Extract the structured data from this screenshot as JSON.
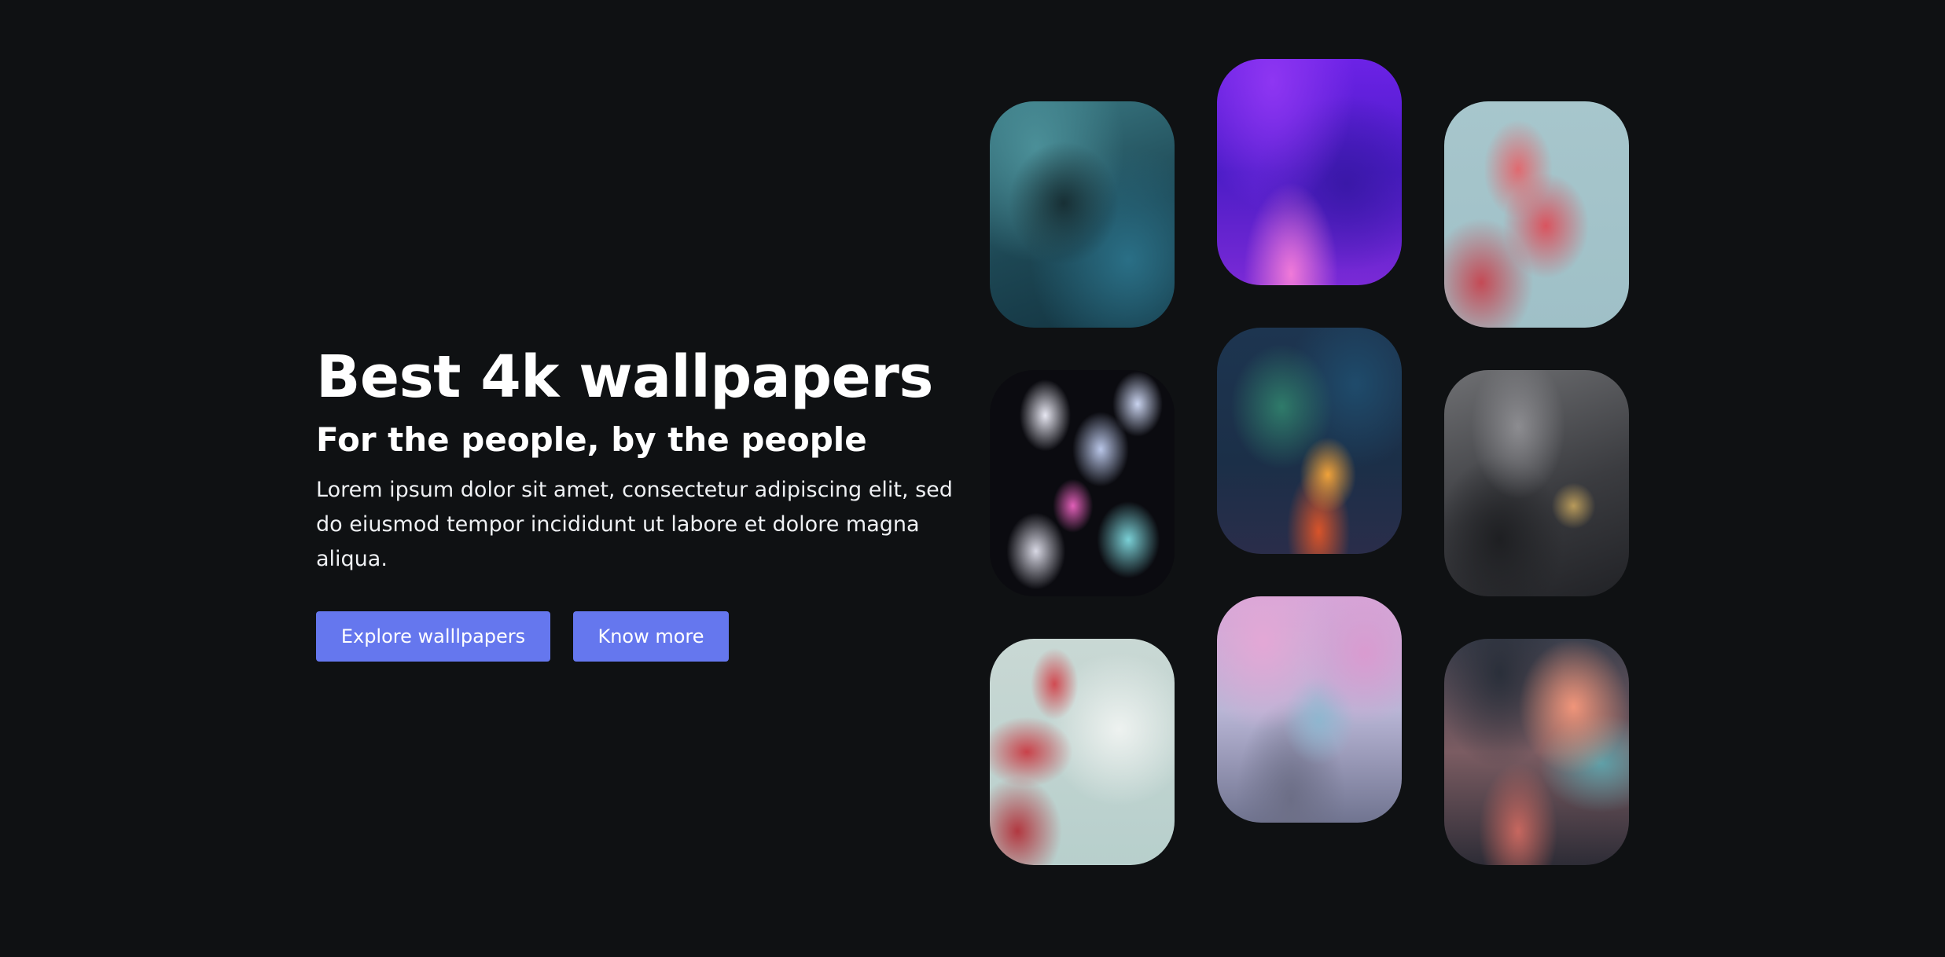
{
  "hero": {
    "title": "Best 4k wallpapers",
    "subtitle": "For the people, by the people",
    "description": "Lorem ipsum dolor sit amet, consectetur adipiscing elit, sed do eiusmod tempor incididunt ut labore et dolore magna aliqua.",
    "buttons": {
      "explore_label": "Explore walllpapers",
      "know_more_label": "Know more"
    }
  },
  "colors": {
    "background": "#0f1113",
    "accent": "#6577ee",
    "text": "#ffffff"
  },
  "wallpapers": [
    {
      "subject": "teal nebula"
    },
    {
      "subject": "purple nebula"
    },
    {
      "subject": "cherry blossom branch"
    },
    {
      "subject": "iridescent abstract"
    },
    {
      "subject": "colorful smoke clouds"
    },
    {
      "subject": "grey marble with gold"
    },
    {
      "subject": "red blossom against sky"
    },
    {
      "subject": "anime cherry blossom road"
    },
    {
      "subject": "sunset clouds"
    }
  ]
}
